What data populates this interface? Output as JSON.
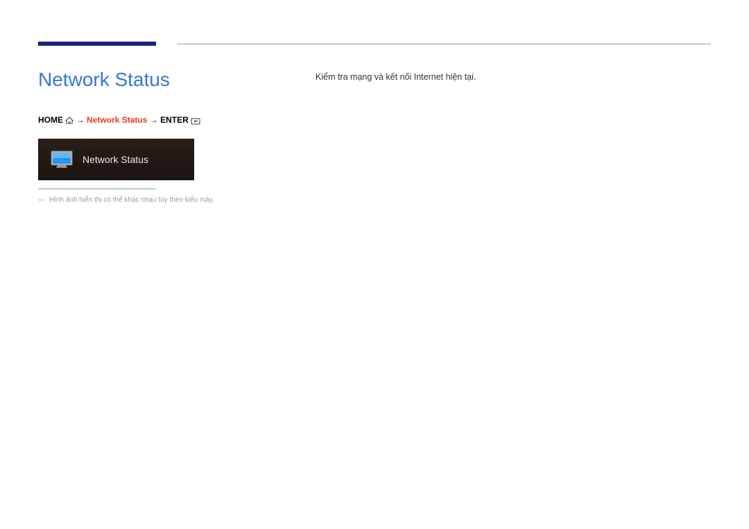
{
  "page_title": "Network Status",
  "breadcrumb": {
    "home": "HOME",
    "arrow1": "→",
    "highlight": "Network Status",
    "arrow2": "→",
    "enter": "ENTER"
  },
  "menu_item": {
    "label": "Network Status"
  },
  "note_dash": "―",
  "note": "Hình ảnh hiển thị có thể khác nhau tùy theo kiểu máy.",
  "description": "Kiểm tra mạng và kết nối Internet hiện tại."
}
